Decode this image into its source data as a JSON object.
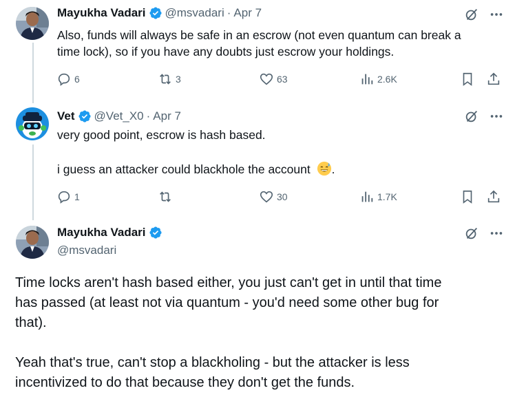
{
  "tweets": [
    {
      "name": "Mayukha Vadari",
      "handle": "@msvadari",
      "separator": "·",
      "date": "Apr 7",
      "lines": [
        "Also, funds will always be safe in an escrow (not even quantum can break a",
        "time lock), so if you have any doubts just escrow your holdings."
      ],
      "metrics": {
        "replies": "6",
        "reposts": "3",
        "likes": "63",
        "views": "2.6K"
      }
    },
    {
      "name": "Vet",
      "handle": "@Vet_X0",
      "separator": "·",
      "date": "Apr 7",
      "line1": "very good point, escrow is hash based.",
      "line2": "i guess an attacker could blackhole the account",
      "line2_end": ".",
      "metrics": {
        "replies": "1",
        "reposts": "",
        "likes": "30",
        "views": "1.7K"
      }
    },
    {
      "name": "Mayukha Vadari",
      "handle": "@msvadari",
      "para1_lines": [
        "Time locks aren't hash based either, you just can't get in until that time",
        "has passed (at least not via quantum - you'd need some other bug for",
        "that)."
      ],
      "para2_lines": [
        "Yeah that's true, can't stop a blackholing - but the attacker is less",
        "incentivized to do that because they don't get the funds."
      ]
    }
  ],
  "colors": {
    "text": "#0f1419",
    "secondary": "#536471",
    "verified": "#1d9bf0",
    "thread_line": "#cfd9de"
  },
  "icons": {
    "verified": "verified-badge-icon",
    "grok": "grok-icon",
    "more": "more-icon",
    "reply": "reply-icon",
    "repost": "repost-icon",
    "like": "like-icon",
    "views": "views-icon",
    "bookmark": "bookmark-icon",
    "share": "share-icon",
    "emoji": "sweat-smile-emoji"
  }
}
